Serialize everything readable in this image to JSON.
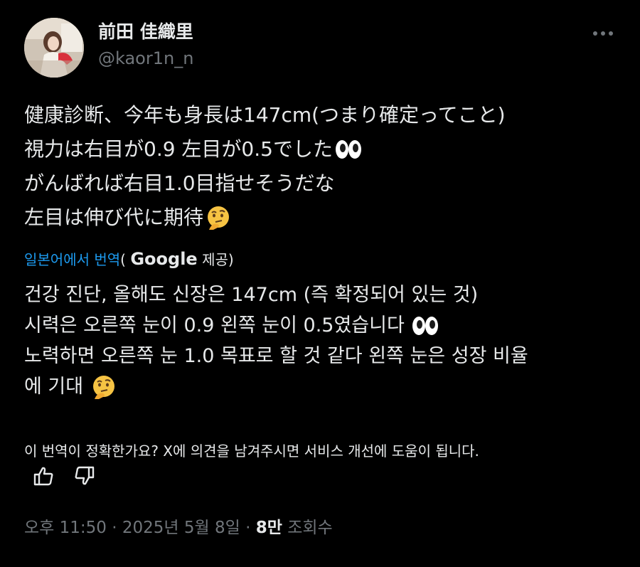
{
  "author": {
    "display_name": "前田 佳織里",
    "handle": "@kaor1n_n"
  },
  "tweet": {
    "lines": [
      "健康診断、今年も身長は147cm(つまり確定ってこと)",
      "視力は右目が0.9 左目が0.5でした",
      "がんばれば右目1.0目指せそうだな",
      "左目は伸び代に期待"
    ],
    "emojis": [
      "eyes-emoji",
      "thinking-face-emoji"
    ]
  },
  "translation": {
    "link_text": "일본어에서 번역",
    "paren_open": "(",
    "provider": "Google",
    "provided_suffix": "제공)",
    "lines": [
      "건강 진단, 올해도 신장은 147cm (즉 확정되어 있는 것)",
      "시력은 오른쪽 눈이 0.9 왼쪽 눈이 0.5였습니다",
      "노력하면 오른쪽 눈 1.0 목표로 할 것 같다 왼쪽 눈은 성장 비율",
      "에 기대"
    ]
  },
  "feedback": {
    "question": "이 번역이 정확한가요? X에 의견을 남겨주시면 서비스 개선에 도움이 됩니다."
  },
  "meta": {
    "time": "오후 11:50",
    "separator": "·",
    "date": "2025년 5월 8일",
    "views_count": "8만",
    "views_label": "조회수"
  },
  "colors": {
    "background": "#000000",
    "text": "#e7e9ea",
    "secondary": "#71767b",
    "link": "#1d9bf0"
  }
}
